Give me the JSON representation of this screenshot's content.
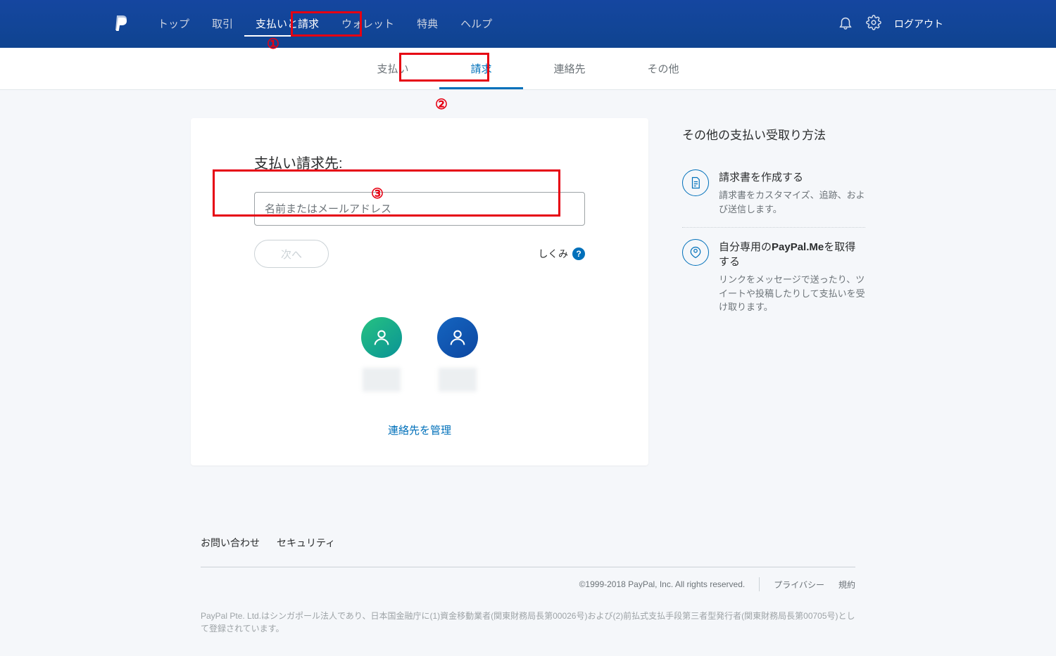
{
  "header": {
    "nav": [
      {
        "label": "トップ"
      },
      {
        "label": "取引"
      },
      {
        "label": "支払いと請求",
        "active": true
      },
      {
        "label": "ウォレット"
      },
      {
        "label": "特典"
      },
      {
        "label": "ヘルプ"
      }
    ],
    "logout": "ログアウト"
  },
  "subnav": [
    {
      "label": "支払い"
    },
    {
      "label": "請求",
      "active": true
    },
    {
      "label": "連絡先"
    },
    {
      "label": "その他"
    }
  ],
  "main": {
    "title": "支払い請求先:",
    "input_placeholder": "名前またはメールアドレス",
    "next_btn": "次へ",
    "how_it_works": "しくみ",
    "manage_contacts": "連絡先を管理"
  },
  "side": {
    "title": "その他の支払い受取り方法",
    "items": [
      {
        "title_plain": "請求書を作成する",
        "desc": "請求書をカスタマイズ、追跡、および送信します。"
      },
      {
        "title_pre": "自分専用の",
        "title_bold": "PayPal.Me",
        "title_post": "を取得する",
        "desc": "リンクをメッセージで送ったり、ツイートや投稿したりして支払いを受け取ります。"
      }
    ]
  },
  "footer": {
    "links_top": [
      {
        "label": "お問い合わせ"
      },
      {
        "label": "セキュリティ"
      }
    ],
    "copyright": "©1999-2018 PayPal, Inc. All rights reserved.",
    "links_right": [
      {
        "label": "プライバシー"
      },
      {
        "label": "規約"
      }
    ],
    "note": "PayPal Pte. Ltd.はシンガポール法人であり、日本国金融庁に(1)資金移動業者(関東財務局長第00026号)および(2)前払式支払手段第三者型発行者(関東財務局長第00705号)として登録されています。"
  },
  "annotations": {
    "one": "①",
    "two": "②",
    "three": "③"
  }
}
